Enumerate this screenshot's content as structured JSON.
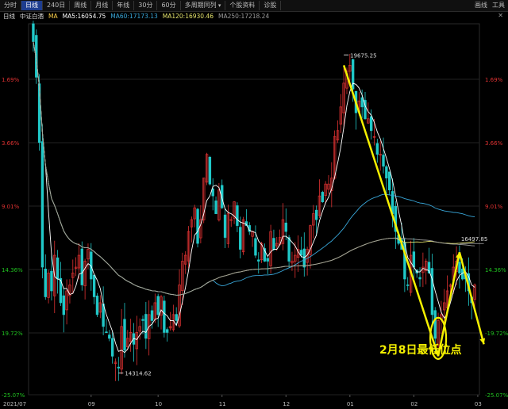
{
  "toolbar": {
    "tabs": [
      {
        "label": "分时",
        "active": false
      },
      {
        "label": "日线",
        "active": true
      },
      {
        "label": "240日",
        "active": false
      },
      {
        "label": "周线",
        "active": false
      },
      {
        "label": "月线",
        "active": false
      },
      {
        "label": "年线",
        "active": false
      },
      {
        "label": "30分",
        "active": false
      },
      {
        "label": "60分",
        "active": false
      },
      {
        "label": "多周期同列",
        "active": false,
        "dropdown": true
      },
      {
        "label": "个股资料",
        "active": false
      },
      {
        "label": "诊股",
        "active": false
      }
    ],
    "right": {
      "chart_label": "画线",
      "tools_label": "工具"
    }
  },
  "info": {
    "period": "日线",
    "name": "中证白酒",
    "ma_label": "MA",
    "ma5": "MA5:16054.75",
    "ma60": "MA60:17173.13",
    "ma120": "MA120:16930.46",
    "ma250": "MA250:17218.24"
  },
  "colors": {
    "up": "#e03232",
    "down": "#20c8c8",
    "ma5": "#ffffff",
    "ma60": "#38a6d8",
    "ma120": "#e4e36c",
    "ma250": "#9c9c9c",
    "annotation": "#f5f000"
  },
  "axis": {
    "left_labels": [
      "1.69%",
      "3.66%",
      "9.01%",
      "14.36%",
      "19.72%",
      "-25.07%"
    ],
    "right_labels": [
      "1.69%",
      "3.66%",
      "9.01%",
      "14.36%",
      "-19.72%",
      "-25.07%"
    ],
    "x_labels": [
      "2021/07",
      "09",
      "10",
      "11",
      "12",
      "01",
      "02",
      "03"
    ]
  },
  "annotations": {
    "high_label": "19675.25",
    "low_label": "14314.62",
    "recent_high_label": "16497.85",
    "note": "2月8日最低位点"
  },
  "chart_data": {
    "type": "candlestick",
    "title": "",
    "price_range": [
      13950,
      20200
    ],
    "axis_percent_labels": [
      "1.69%",
      "3.66%",
      "9.01%",
      "14.36%",
      "19.72%",
      "-25.07%"
    ],
    "closes": [
      19900,
      19300,
      18200,
      16100,
      15600,
      16000,
      15700,
      16300,
      15900,
      15500,
      15300,
      15700,
      15800,
      16000,
      16100,
      16300,
      15800,
      16200,
      16400,
      15900,
      15600,
      15300,
      15500,
      15100,
      15000,
      14900,
      14600,
      14500,
      14400,
      15100,
      14700,
      14900,
      15000,
      14800,
      15000,
      15100,
      15200,
      14900,
      15300,
      15200,
      15500,
      15300,
      15600,
      15000,
      15000,
      15100,
      15300,
      15200,
      15800,
      16200,
      16300,
      16700,
      16900,
      17100,
      16500,
      16900,
      17600,
      18000,
      17500,
      17300,
      17000,
      17400,
      17100,
      16600,
      17000,
      16900,
      17200,
      16800,
      16400,
      16900,
      16800,
      16700,
      16700,
      16300,
      16200,
      16500,
      16200,
      16200,
      16700,
      16400,
      16500,
      16600,
      16900,
      16700,
      16200,
      16200,
      16300,
      16400,
      16300,
      16100,
      16400,
      16800,
      17000,
      16900,
      17300,
      17200,
      17500,
      17500,
      17600,
      18300,
      18400,
      18800,
      19200,
      19400,
      19500,
      19100,
      18700,
      18900,
      18800,
      18600,
      18600,
      18400,
      18300,
      18000,
      18000,
      17800,
      17600,
      17400,
      17000,
      16700,
      16500,
      16400,
      15900,
      15800,
      16300,
      16100,
      16000,
      15900,
      16100,
      16200,
      16000,
      15300,
      14900,
      15200,
      15300,
      15500,
      15700,
      15800,
      16100,
      16200,
      16000,
      15900,
      15900,
      15700,
      15500,
      15800
    ],
    "high_value": 19675.25,
    "low_value": 14314.62,
    "recent_high_value": 16497.85,
    "trendlines": [
      {
        "name": "downtrend-main",
        "from": {
          "index": 102,
          "value": 19500
        },
        "to": {
          "index": 133,
          "value": 14600
        }
      },
      {
        "name": "rebound",
        "from": {
          "index": 133,
          "value": 14600
        },
        "to": {
          "index": 140,
          "value": 16350
        }
      },
      {
        "name": "second-decline",
        "from": {
          "index": 140,
          "value": 16350
        },
        "to": {
          "index": 148,
          "value": 14800
        }
      }
    ]
  }
}
